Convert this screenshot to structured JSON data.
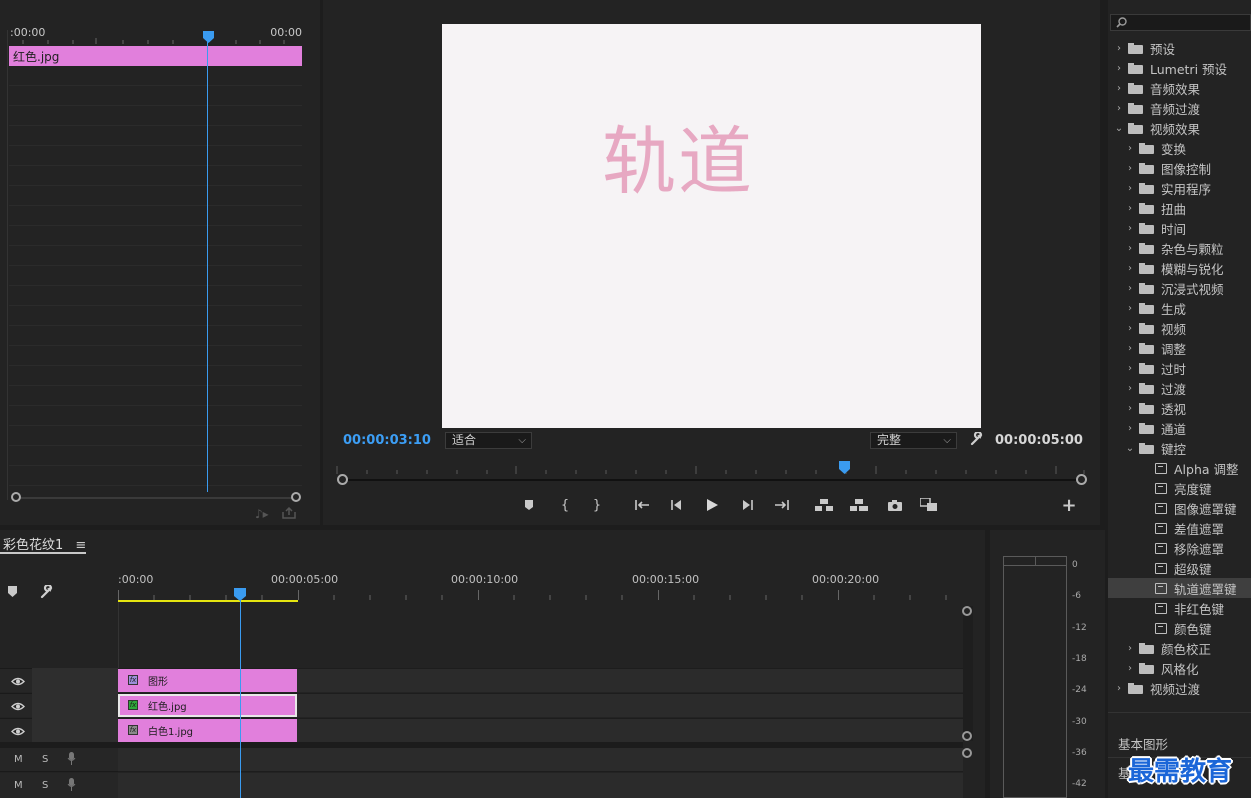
{
  "source": {
    "start_tc": ":00:00",
    "end_tc": "00:00",
    "clip_label": "红色.jpg"
  },
  "program": {
    "watermark": "轨道",
    "current_tc": "00:00:03:10",
    "fit_label": "适合",
    "quality_label": "完整",
    "duration_tc": "00:00:05:00"
  },
  "effects": {
    "items": [
      {
        "label": "预设",
        "level": 0,
        "kind": "folder-star",
        "open": false
      },
      {
        "label": "Lumetri 预设",
        "level": 0,
        "kind": "folder-star",
        "open": false
      },
      {
        "label": "音频效果",
        "level": 0,
        "kind": "folder",
        "open": false
      },
      {
        "label": "音频过渡",
        "level": 0,
        "kind": "folder",
        "open": false
      },
      {
        "label": "视频效果",
        "level": 0,
        "kind": "folder",
        "open": true
      },
      {
        "label": "变换",
        "level": 1,
        "kind": "folder",
        "open": false
      },
      {
        "label": "图像控制",
        "level": 1,
        "kind": "folder",
        "open": false
      },
      {
        "label": "实用程序",
        "level": 1,
        "kind": "folder",
        "open": false
      },
      {
        "label": "扭曲",
        "level": 1,
        "kind": "folder",
        "open": false
      },
      {
        "label": "时间",
        "level": 1,
        "kind": "folder",
        "open": false
      },
      {
        "label": "杂色与颗粒",
        "level": 1,
        "kind": "folder",
        "open": false
      },
      {
        "label": "模糊与锐化",
        "level": 1,
        "kind": "folder",
        "open": false
      },
      {
        "label": "沉浸式视频",
        "level": 1,
        "kind": "folder",
        "open": false
      },
      {
        "label": "生成",
        "level": 1,
        "kind": "folder",
        "open": false
      },
      {
        "label": "视频",
        "level": 1,
        "kind": "folder",
        "open": false
      },
      {
        "label": "调整",
        "level": 1,
        "kind": "folder",
        "open": false
      },
      {
        "label": "过时",
        "level": 1,
        "kind": "folder",
        "open": false
      },
      {
        "label": "过渡",
        "level": 1,
        "kind": "folder",
        "open": false
      },
      {
        "label": "透视",
        "level": 1,
        "kind": "folder",
        "open": false
      },
      {
        "label": "通道",
        "level": 1,
        "kind": "folder",
        "open": false
      },
      {
        "label": "键控",
        "level": 1,
        "kind": "folder",
        "open": true
      },
      {
        "label": "Alpha 调整",
        "level": 2,
        "kind": "effect"
      },
      {
        "label": "亮度键",
        "level": 2,
        "kind": "effect"
      },
      {
        "label": "图像遮罩键",
        "level": 2,
        "kind": "effect"
      },
      {
        "label": "差值遮罩",
        "level": 2,
        "kind": "effect"
      },
      {
        "label": "移除遮罩",
        "level": 2,
        "kind": "effect"
      },
      {
        "label": "超级键",
        "level": 2,
        "kind": "effect"
      },
      {
        "label": "轨道遮罩键",
        "level": 2,
        "kind": "effect",
        "selected": true
      },
      {
        "label": "非红色键",
        "level": 2,
        "kind": "effect"
      },
      {
        "label": "颜色键",
        "level": 2,
        "kind": "effect"
      },
      {
        "label": "颜色校正",
        "level": 1,
        "kind": "folder",
        "open": false
      },
      {
        "label": "风格化",
        "level": 1,
        "kind": "folder",
        "open": false
      },
      {
        "label": "视频过渡",
        "level": 0,
        "kind": "folder",
        "open": false
      }
    ],
    "section1": "基本图形",
    "section2": "基"
  },
  "timeline": {
    "tab_label": "彩色花纹1",
    "ruler_labels": [
      ":00:00",
      "00:00:05:00",
      "00:00:10:00",
      "00:00:15:00",
      "00:00:20:00"
    ],
    "clips": [
      {
        "label": "图形"
      },
      {
        "label": "红色.jpg"
      },
      {
        "label": "白色1.jpg"
      }
    ],
    "audio_m": "M",
    "audio_s": "S"
  },
  "meter": {
    "labels": [
      "0",
      "-6",
      "-12",
      "-18",
      "-24",
      "-30",
      "-36",
      "-42"
    ]
  },
  "logo_text": "最需教育"
}
